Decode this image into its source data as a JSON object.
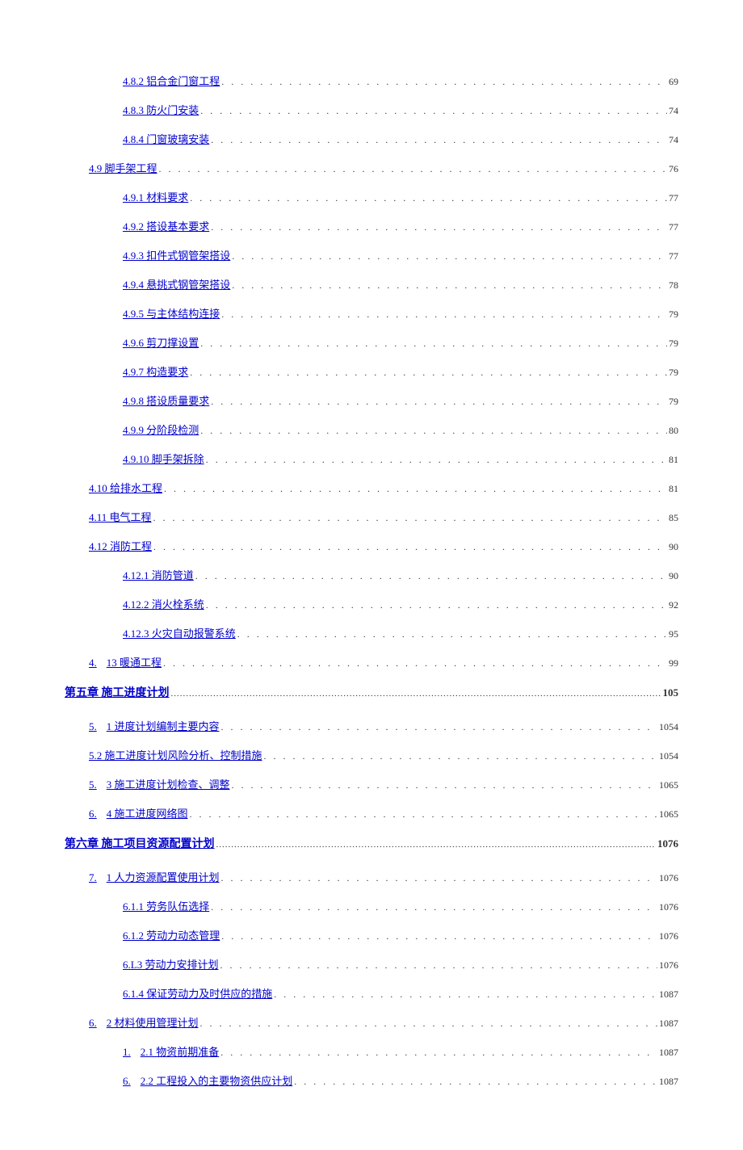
{
  "entries": [
    {
      "level": 3,
      "label": "4.8.2 铝合金门窗工程",
      "page": "69"
    },
    {
      "level": 3,
      "label": "4.8.3 防火门安装",
      "page": "74"
    },
    {
      "level": 3,
      "label": "4.8.4 门窗玻璃安装",
      "page": "74"
    },
    {
      "level": 2,
      "label": "4.9 脚手架工程",
      "page": "76"
    },
    {
      "level": 3,
      "label": "4.9.1 材料要求",
      "page": "77"
    },
    {
      "level": 3,
      "label": "4.9.2 搭设基本要求",
      "page": "77"
    },
    {
      "level": 3,
      "label": "4.9.3 扣件式钢管架搭设",
      "page": "77"
    },
    {
      "level": 3,
      "label": "4.9.4 悬挑式钢管架搭设",
      "page": "78"
    },
    {
      "level": 3,
      "label": "4.9.5 与主体结构连接",
      "page": "79"
    },
    {
      "level": 3,
      "label": "4.9.6 剪刀撑设置",
      "page": "79"
    },
    {
      "level": 3,
      "label": "4.9.7 构造要求",
      "page": "79"
    },
    {
      "level": 3,
      "label": "4.9.8 搭设质量要求",
      "page": "79"
    },
    {
      "level": 3,
      "label": "4.9.9 分阶段检测",
      "page": "80"
    },
    {
      "level": 3,
      "label": "4.9.10 脚手架拆除",
      "page": "81"
    },
    {
      "level": 2,
      "label": "4.10 给排水工程",
      "page": "81"
    },
    {
      "level": 2,
      "label": "4.11 电气工程",
      "page": "85"
    },
    {
      "level": 2,
      "label": "4.12 消防工程",
      "page": "90"
    },
    {
      "level": 3,
      "label": "4.12.1 消防管道",
      "page": "90"
    },
    {
      "level": 3,
      "label": "4.12.2 消火栓系统",
      "page": "92"
    },
    {
      "level": 3,
      "label": "4.12.3 火灾自动报警系统",
      "page": "95"
    },
    {
      "level": 2,
      "split": true,
      "prefix": "4.",
      "label": "13 暖通工程",
      "page": "99"
    },
    {
      "level": 1,
      "label": "第五章 施工进度计划",
      "page": "105"
    },
    {
      "level": 2,
      "split": true,
      "prefix": "5.",
      "label": "1 进度计划编制主要内容",
      "page": "1054"
    },
    {
      "level": 2,
      "label": "5.2 施工进度计划风险分析、控制措施",
      "page": "1054"
    },
    {
      "level": 2,
      "split": true,
      "prefix": "5.",
      "label": "3 施工进度计划检查、调整",
      "page": "1065"
    },
    {
      "level": 2,
      "split": true,
      "prefix": "6.",
      "label": "4 施工进度网络图",
      "page": "1065"
    },
    {
      "level": 1,
      "label": "第六章 施工项目资源配置计划",
      "page": "1076"
    },
    {
      "level": 2,
      "split": true,
      "prefix": "7.",
      "label": "1 人力资源配置使用计划",
      "page": "1076"
    },
    {
      "level": 3,
      "label": "6.1.1 劳务队伍选择",
      "page": "1076"
    },
    {
      "level": 3,
      "label": "6.1.2 劳动力动态管理",
      "page": "1076"
    },
    {
      "level": 3,
      "label": "6.L3 劳动力安排计划",
      "page": "1076"
    },
    {
      "level": 3,
      "label": "6.1.4 保证劳动力及时供应的措施",
      "page": "1087"
    },
    {
      "level": 2,
      "split": true,
      "prefix": "6.",
      "label": "2 材料使用管理计划",
      "page": "1087"
    },
    {
      "level": 3,
      "split": true,
      "prefix": "1.",
      "label": "2.1 物资前期准备",
      "page": "1087"
    },
    {
      "level": 3,
      "split": true,
      "prefix": "6.",
      "label": "2.2 工程投入的主要物资供应计划",
      "page": "1087"
    }
  ]
}
